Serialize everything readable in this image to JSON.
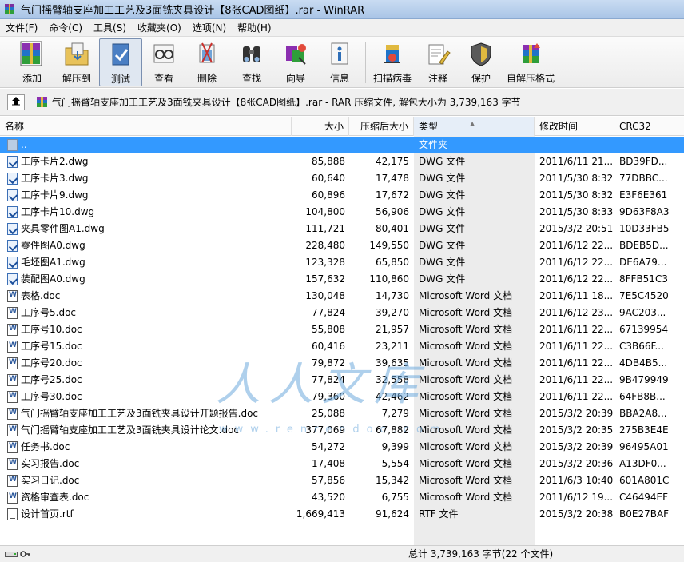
{
  "window": {
    "title": "气门摇臂轴支座加工工艺及3面铣夹具设计【8张CAD图纸】.rar - WinRAR"
  },
  "menu": [
    "文件(F)",
    "命令(C)",
    "工具(S)",
    "收藏夹(O)",
    "选项(N)",
    "帮助(H)"
  ],
  "toolbar": {
    "add": "添加",
    "extract": "解压到",
    "test": "测试",
    "view": "查看",
    "delete": "删除",
    "find": "查找",
    "wizard": "向导",
    "info": "信息",
    "virus": "扫描病毒",
    "comment": "注释",
    "protect": "保护",
    "sfx": "自解压格式"
  },
  "address": {
    "text": "气门摇臂轴支座加工工艺及3面铣夹具设计【8张CAD图纸】.rar - RAR 压缩文件, 解包大小为 3,739,163 字节"
  },
  "columns": {
    "name": "名称",
    "size": "大小",
    "packed": "压缩后大小",
    "type": "类型",
    "mtime": "修改时间",
    "crc": "CRC32"
  },
  "files": [
    {
      "name": "..",
      "size": "",
      "packed": "",
      "type": "文件夹",
      "mtime": "",
      "crc": "",
      "icon": "up-folder-icon"
    },
    {
      "name": "工序卡片2.dwg",
      "size": "85,888",
      "packed": "42,175",
      "type": "DWG 文件",
      "mtime": "2011/6/11 21...",
      "crc": "BD39FD...",
      "icon": "dwg-file-icon"
    },
    {
      "name": "工序卡片3.dwg",
      "size": "60,640",
      "packed": "17,478",
      "type": "DWG 文件",
      "mtime": "2011/5/30 8:32",
      "crc": "77DBBC...",
      "icon": "dwg-file-icon"
    },
    {
      "name": "工序卡片9.dwg",
      "size": "60,896",
      "packed": "17,672",
      "type": "DWG 文件",
      "mtime": "2011/5/30 8:32",
      "crc": "E3F6E361",
      "icon": "dwg-file-icon"
    },
    {
      "name": "工序卡片10.dwg",
      "size": "104,800",
      "packed": "56,906",
      "type": "DWG 文件",
      "mtime": "2011/5/30 8:33",
      "crc": "9D63F8A3",
      "icon": "dwg-file-icon"
    },
    {
      "name": "夹具零件图A1.dwg",
      "size": "111,721",
      "packed": "80,401",
      "type": "DWG 文件",
      "mtime": "2015/3/2 20:51",
      "crc": "10D33FB5",
      "icon": "dwg-file-icon"
    },
    {
      "name": "零件图A0.dwg",
      "size": "228,480",
      "packed": "149,550",
      "type": "DWG 文件",
      "mtime": "2011/6/12 22...",
      "crc": "BDEB5D...",
      "icon": "dwg-file-icon"
    },
    {
      "name": "毛坯图A1.dwg",
      "size": "123,328",
      "packed": "65,850",
      "type": "DWG 文件",
      "mtime": "2011/6/12 22...",
      "crc": "DE6A79...",
      "icon": "dwg-file-icon"
    },
    {
      "name": "装配图A0.dwg",
      "size": "157,632",
      "packed": "110,860",
      "type": "DWG 文件",
      "mtime": "2011/6/12 22...",
      "crc": "8FFB51C3",
      "icon": "dwg-file-icon"
    },
    {
      "name": "表格.doc",
      "size": "130,048",
      "packed": "14,730",
      "type": "Microsoft Word 文档",
      "mtime": "2011/6/11 18...",
      "crc": "7E5C4520",
      "icon": "word-file-icon"
    },
    {
      "name": "工序号5.doc",
      "size": "77,824",
      "packed": "39,270",
      "type": "Microsoft Word 文档",
      "mtime": "2011/6/12 23...",
      "crc": "9AC203...",
      "icon": "word-file-icon"
    },
    {
      "name": "工序号10.doc",
      "size": "55,808",
      "packed": "21,957",
      "type": "Microsoft Word 文档",
      "mtime": "2011/6/11 22...",
      "crc": "67139954",
      "icon": "word-file-icon"
    },
    {
      "name": "工序号15.doc",
      "size": "60,416",
      "packed": "23,211",
      "type": "Microsoft Word 文档",
      "mtime": "2011/6/11 22...",
      "crc": "C3B66F...",
      "icon": "word-file-icon"
    },
    {
      "name": "工序号20.doc",
      "size": "79,872",
      "packed": "39,635",
      "type": "Microsoft Word 文档",
      "mtime": "2011/6/11 22...",
      "crc": "4DB4B5...",
      "icon": "word-file-icon"
    },
    {
      "name": "工序号25.doc",
      "size": "77,824",
      "packed": "32,558",
      "type": "Microsoft Word 文档",
      "mtime": "2011/6/11 22...",
      "crc": "9B479949",
      "icon": "word-file-icon"
    },
    {
      "name": "工序号30.doc",
      "size": "79,360",
      "packed": "42,462",
      "type": "Microsoft Word 文档",
      "mtime": "2011/6/11 22...",
      "crc": "64FB8B...",
      "icon": "word-file-icon"
    },
    {
      "name": "气门摇臂轴支座加工工艺及3面铣夹具设计开题报告.doc",
      "size": "25,088",
      "packed": "7,279",
      "type": "Microsoft Word 文档",
      "mtime": "2015/3/2 20:39",
      "crc": "BBA2A8...",
      "icon": "word-file-icon"
    },
    {
      "name": "气门摇臂轴支座加工工艺及3面铣夹具设计论文.doc",
      "size": "377,069",
      "packed": "67,882",
      "type": "Microsoft Word 文档",
      "mtime": "2015/3/2 20:35",
      "crc": "275B3E4E",
      "icon": "word-file-icon"
    },
    {
      "name": "任务书.doc",
      "size": "54,272",
      "packed": "9,399",
      "type": "Microsoft Word 文档",
      "mtime": "2015/3/2 20:39",
      "crc": "96495A01",
      "icon": "word-file-icon"
    },
    {
      "name": "实习报告.doc",
      "size": "17,408",
      "packed": "5,554",
      "type": "Microsoft Word 文档",
      "mtime": "2015/3/2 20:36",
      "crc": "A13DF0...",
      "icon": "word-file-icon"
    },
    {
      "name": "实习日记.doc",
      "size": "57,856",
      "packed": "15,342",
      "type": "Microsoft Word 文档",
      "mtime": "2011/6/3 10:40",
      "crc": "601A801C",
      "icon": "word-file-icon"
    },
    {
      "name": "资格审查表.doc",
      "size": "43,520",
      "packed": "6,755",
      "type": "Microsoft Word 文档",
      "mtime": "2011/6/12 19...",
      "crc": "C46494EF",
      "icon": "word-file-icon"
    },
    {
      "name": "设计首页.rtf",
      "size": "1,669,413",
      "packed": "91,624",
      "type": "RTF 文件",
      "mtime": "2015/3/2 20:38",
      "crc": "B0E27BAF",
      "icon": "rtf-file-icon"
    }
  ],
  "watermark": {
    "text": "人人文库",
    "url": "www.renrendoc.com"
  },
  "status": {
    "text": "总计 3,739,163 字节(22 个文件)"
  }
}
